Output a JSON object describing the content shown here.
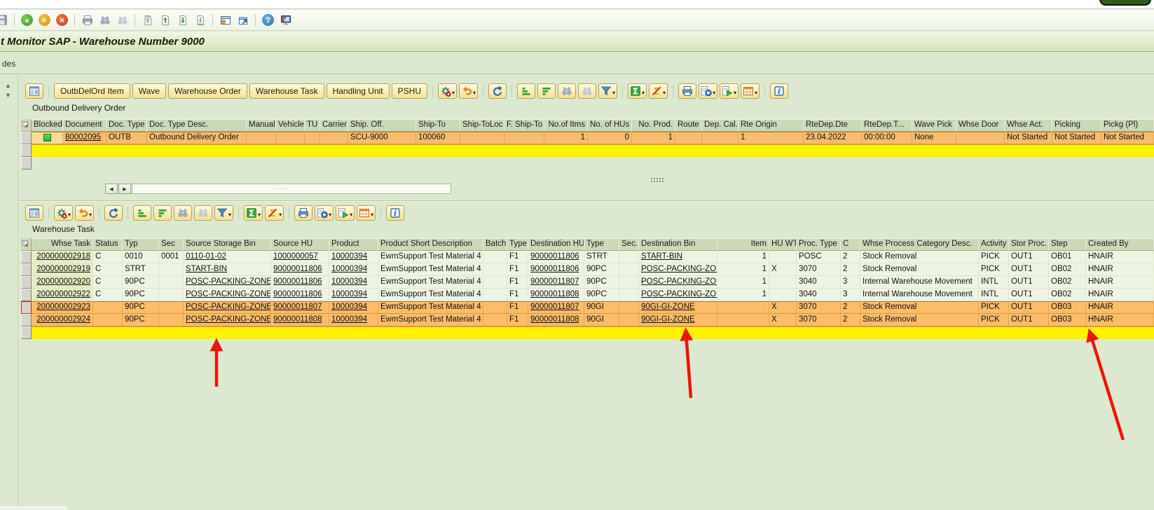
{
  "window": {
    "title": "t Monitor SAP - Warehouse Number 9000",
    "left_partial_text": "des"
  },
  "colors": {
    "selected_row": "#fcbd6b",
    "normal_row": "#edf5e2",
    "key_column": "#e6edc4",
    "highlight_stripe": "#fff200",
    "grid_header": "#cbd9b9",
    "button_face": "#f5e193",
    "annotation_arrow": "#ee1409",
    "blocked_status_green": "#2ecc2e"
  },
  "sys_toolbar": {
    "items": [
      "ico:save",
      "sep",
      "ico:back",
      "ico:exit",
      "ico:cancel",
      "sep",
      "ico:print",
      "ico:find",
      "ico:find-next",
      "sep",
      "ico:first-page",
      "ico:page-up",
      "ico:page-down",
      "ico:last-page",
      "sep",
      "ico:new-session",
      "ico:create-shortcut",
      "sep",
      "ico:help",
      "ico:customize-layout"
    ]
  },
  "panels": {
    "outbound": {
      "label": "Outbound Delivery Order",
      "toolbar": {
        "items": [
          "ico:detail",
          "sep",
          "btn:OutbDelOrd Item",
          "btn:Wave",
          "btn:Warehouse Order",
          "btn:Warehouse Task",
          "btn:Handling Unit",
          "btn:PSHU",
          "sep",
          "ico:settings*",
          "ico:undo*",
          "sep",
          "ico:refresh",
          "sep",
          "ico:sort-asc",
          "ico:sort-desc",
          "ico:find",
          "ico:find-next",
          "ico:filter*",
          "sep",
          "ico:sum*",
          "ico:subtotal*",
          "sep",
          "ico:print-grid",
          "ico:export*",
          "ico:export-file*",
          "ico:views*",
          "sep",
          "ico:info"
        ]
      },
      "columns": [
        "Blocked",
        "Document",
        "Doc. Type",
        "Doc. Type Desc.",
        "Manually",
        "Vehicle",
        "TU",
        "Carrier",
        "Ship. Off.",
        "Ship-To",
        "Ship-ToLoc",
        "F. Ship-To",
        "No.of Itms",
        "No. of HUs",
        "No. Prod.",
        "Route",
        "Dep. Cal.",
        "Rte Origin",
        "RteDep.Dte",
        "RteDep.T...",
        "Wave Pick",
        "Whse Door",
        "Whse Act.",
        "Picking",
        "Pickg (Pl)"
      ],
      "rows": [
        {
          "selected": true,
          "icon": "green-square",
          "cells": [
            "",
            "80002095",
            "OUTB",
            "Outbound Delivery Order",
            "",
            "",
            "",
            "",
            "SCU-9000",
            "100060",
            "",
            "",
            "1",
            "0",
            "1",
            "",
            "",
            "1",
            "23.04.2022",
            "00:00:00",
            "None",
            "",
            "Not Started",
            "Not Started",
            "Not Started"
          ]
        }
      ]
    },
    "warehouse_task": {
      "label": "Warehouse Task",
      "toolbar": {
        "items": [
          "ico:detail",
          "sep",
          "ico:settings*",
          "ico:undo*",
          "sep",
          "ico:refresh",
          "sep",
          "ico:sort-asc",
          "ico:sort-desc",
          "ico:find",
          "ico:find-next",
          "ico:filter*",
          "sep",
          "ico:sum*",
          "ico:subtotal*",
          "sep",
          "ico:print-grid",
          "ico:export*",
          "ico:export-file*",
          "ico:views*",
          "sep",
          "ico:info"
        ]
      },
      "columns": [
        "Whse Task",
        "Status",
        "Typ",
        "Sec",
        "Source Storage Bin",
        "Source HU",
        "Product",
        "Product Short Description",
        "Batch",
        "Type",
        "Destination HU",
        "Type",
        "Sec.",
        "Destination Bin",
        "Item",
        "HU WT",
        "Proc. Type",
        "C",
        "Whse Process Category Desc.",
        "Activity",
        "Stor Proc.",
        "Step",
        "Created By"
      ],
      "rows": [
        {
          "selected": false,
          "cells": [
            "200000002918",
            "C",
            "0010",
            "0001",
            "0110-01-02",
            "1000000057",
            "10000394",
            "EwmSupport Test Material 4",
            "",
            "F1",
            "90000011806",
            "STRT",
            "",
            "START-BIN",
            "1",
            "",
            "POSC",
            "2",
            "Stock Removal",
            "PICK",
            "OUT1",
            "OB01",
            "HNAIR"
          ]
        },
        {
          "selected": false,
          "cells": [
            "200000002919",
            "C",
            "STRT",
            "",
            "START-BIN",
            "90000011806",
            "10000394",
            "EwmSupport Test Material 4",
            "",
            "F1",
            "90000011806",
            "90PC",
            "",
            "POSC-PACKING-ZONE",
            "1",
            "X",
            "3070",
            "2",
            "Stock Removal",
            "PICK",
            "OUT1",
            "OB02",
            "HNAIR"
          ]
        },
        {
          "selected": false,
          "cells": [
            "200000002920",
            "C",
            "90PC",
            "",
            "POSC-PACKING-ZONE",
            "90000011806",
            "10000394",
            "EwmSupport Test Material 4",
            "",
            "F1",
            "90000011807",
            "90PC",
            "",
            "POSC-PACKING-ZONE",
            "1",
            "",
            "3040",
            "3",
            "Internal Warehouse Movement",
            "INTL",
            "OUT1",
            "OB02",
            "HNAIR"
          ]
        },
        {
          "selected": false,
          "cells": [
            "200000002922",
            "C",
            "90PC",
            "",
            "POSC-PACKING-ZONE",
            "90000011806",
            "10000394",
            "EwmSupport Test Material 4",
            "",
            "F1",
            "90000011808",
            "90PC",
            "",
            "POSC-PACKING-ZONE",
            "1",
            "",
            "3040",
            "3",
            "Internal Warehouse Movement",
            "INTL",
            "OUT1",
            "OB02",
            "HNAIR"
          ]
        },
        {
          "selected": true,
          "focus": true,
          "cells": [
            "200000002923",
            "",
            "90PC",
            "",
            "POSC-PACKING-ZONE",
            "90000011807",
            "10000394",
            "EwmSupport Test Material 4",
            "",
            "F1",
            "90000011807",
            "90GI",
            "",
            "90GI-GI-ZONE",
            "",
            "X",
            "3070",
            "2",
            "Stock Removal",
            "PICK",
            "OUT1",
            "OB03",
            "HNAIR"
          ]
        },
        {
          "selected": true,
          "cells": [
            "200000002924",
            "",
            "90PC",
            "",
            "POSC-PACKING-ZONE",
            "90000011808",
            "10000394",
            "EwmSupport Test Material 4",
            "",
            "F1",
            "90000011808",
            "90GI",
            "",
            "90GI-GI-ZONE",
            "",
            "X",
            "3070",
            "2",
            "Stock Removal",
            "PICK",
            "OUT1",
            "OB03",
            "HNAIR"
          ]
        }
      ]
    }
  },
  "annotations": {
    "red_arrow_count": 3,
    "color": "#ee1409"
  }
}
